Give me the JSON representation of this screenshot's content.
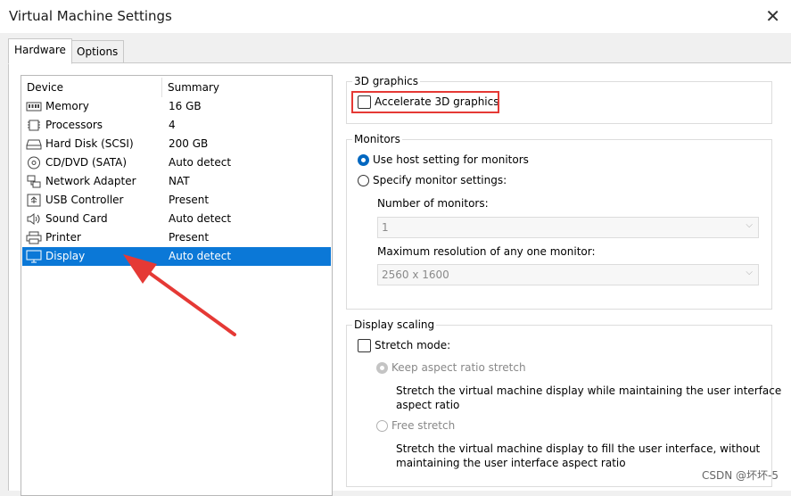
{
  "window": {
    "title": "Virtual Machine Settings"
  },
  "tabs": [
    {
      "label": "Hardware"
    },
    {
      "label": "Options"
    }
  ],
  "device_list": {
    "columns": {
      "device": "Device",
      "summary": "Summary"
    },
    "rows": [
      {
        "name": "Memory",
        "summary": "16 GB",
        "icon": "memory-icon"
      },
      {
        "name": "Processors",
        "summary": "4",
        "icon": "processor-icon"
      },
      {
        "name": "Hard Disk (SCSI)",
        "summary": "200 GB",
        "icon": "hard-disk-icon"
      },
      {
        "name": "CD/DVD (SATA)",
        "summary": "Auto detect",
        "icon": "cd-dvd-icon"
      },
      {
        "name": "Network Adapter",
        "summary": "NAT",
        "icon": "network-adapter-icon"
      },
      {
        "name": "USB Controller",
        "summary": "Present",
        "icon": "usb-icon"
      },
      {
        "name": "Sound Card",
        "summary": "Auto detect",
        "icon": "speaker-icon"
      },
      {
        "name": "Printer",
        "summary": "Present",
        "icon": "printer-icon"
      },
      {
        "name": "Display",
        "summary": "Auto detect",
        "icon": "monitor-icon",
        "selected": true
      }
    ]
  },
  "graphics3d": {
    "label": "3D graphics",
    "accelerate_label": "Accelerate 3D graphics",
    "accelerate_checked": false
  },
  "monitors": {
    "label": "Monitors",
    "use_host_label": "Use host setting for monitors",
    "specify_label": "Specify monitor settings:",
    "number_label": "Number of monitors:",
    "number_value": "1",
    "max_res_label": "Maximum resolution of any one monitor:",
    "max_res_value": "2560 x 1600"
  },
  "display_scaling": {
    "label": "Display scaling",
    "stretch_label": "Stretch mode:",
    "stretch_checked": false,
    "keep_aspect_label": "Keep aspect ratio stretch",
    "keep_aspect_desc_1": "Stretch the virtual machine display while maintaining the user interface",
    "keep_aspect_desc_2": "aspect ratio",
    "free_stretch_label": "Free stretch",
    "free_stretch_desc_1": "Stretch the virtual machine display to fill the user interface, without",
    "free_stretch_desc_2": "maintaining the user interface aspect ratio"
  },
  "watermark": "CSDN @坏坏-5",
  "colors": {
    "selection": "#0b78d7",
    "highlight": "#e53935",
    "radio_on": "#0067c0"
  }
}
